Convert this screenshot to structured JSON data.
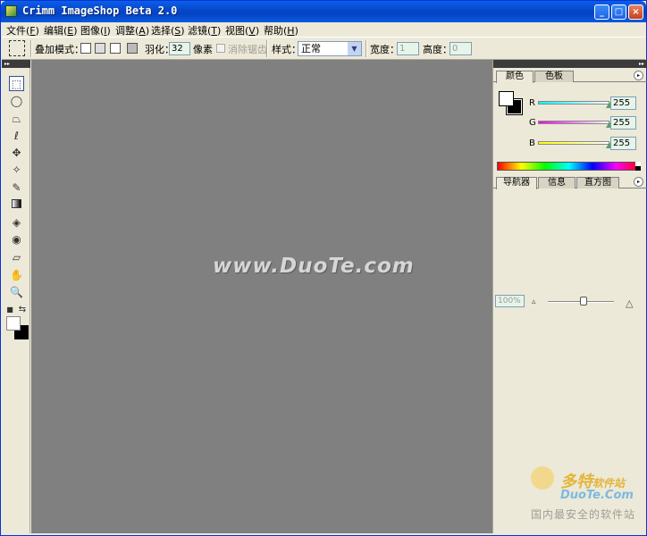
{
  "window": {
    "title": "Crimm ImageShop Beta 2.0",
    "min": "_",
    "max": "□",
    "close": "×"
  },
  "menu": [
    {
      "label": "文件",
      "key": "F"
    },
    {
      "label": "编辑",
      "key": "E"
    },
    {
      "label": "图像",
      "key": "I"
    },
    {
      "label": "调整",
      "key": "A"
    },
    {
      "label": "选择",
      "key": "S"
    },
    {
      "label": "滤镜",
      "key": "T"
    },
    {
      "label": "视图",
      "key": "V"
    },
    {
      "label": "帮助",
      "key": "H"
    }
  ],
  "options": {
    "blend_mode_label": "叠加模式：",
    "feather_label": "羽化：",
    "feather_value": "32",
    "pixel_label": "像素",
    "antialias_label": "消除锯齿",
    "style_label": "样式：",
    "style_value": "正常",
    "width_label": "宽度：",
    "width_value": "1",
    "height_label": "高度：",
    "height_value": "0"
  },
  "canvas": {
    "watermark": "www.DuoTe.com"
  },
  "color_panel": {
    "tabs": [
      "颜色",
      "色板"
    ],
    "channels": [
      {
        "name": "R",
        "value": "255",
        "color": "#00C8C8"
      },
      {
        "name": "G",
        "value": "255",
        "color": "#E020E0"
      },
      {
        "name": "B",
        "value": "255",
        "color": "#E0E020"
      }
    ]
  },
  "nav_panel": {
    "tabs": [
      "导航器",
      "信息",
      "直方图"
    ],
    "zoom": "100%"
  },
  "site_watermark": {
    "brand": "多特",
    "brand_suffix": "软件站",
    "domain": "DuoTe.Com",
    "slogan": "国内最安全的软件站"
  }
}
